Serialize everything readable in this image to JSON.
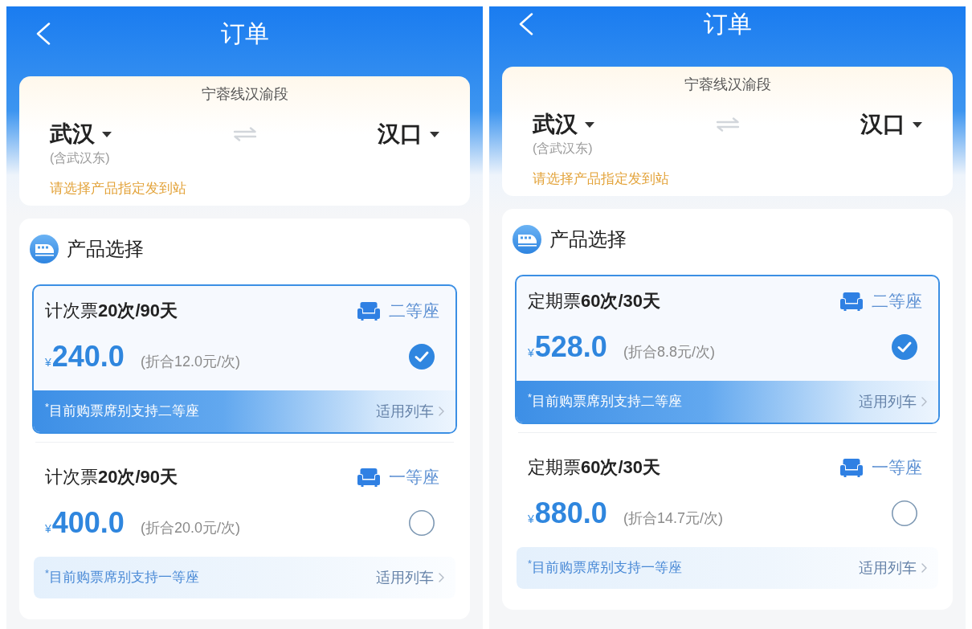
{
  "screens": [
    {
      "header": {
        "title": "订单"
      },
      "route": {
        "line": "宁蓉线汉渝段",
        "from": {
          "station": "武汉",
          "note": "(含武汉东)"
        },
        "to": {
          "station": "汉口"
        },
        "hint": "请选择产品指定发到站"
      },
      "products": {
        "title": "产品选择",
        "items": [
          {
            "name": "计次票**20次/90天**",
            "seat": "二等座",
            "currency": "¥",
            "price": "240.0",
            "per_ride": "(折合12.0元/次)",
            "selected": true,
            "note": "$^{*}$目前购票席别支持二等座",
            "link": "适用列车"
          },
          {
            "name": "计次票**20次/90天**",
            "seat": "一等座",
            "currency": "¥",
            "price": "400.0",
            "per_ride": "(折合20.0元/次)",
            "selected": false,
            "note": "$^{*}$目前购票席别支持一等座",
            "link": "适用列车"
          }
        ]
      }
    },
    {
      "header": {
        "title": "订单"
      },
      "route": {
        "line": "宁蓉线汉渝段",
        "from": {
          "station": "武汉",
          "note": "(含武汉东)"
        },
        "to": {
          "station": "汉口"
        },
        "hint": "请选择产品指定发到站"
      },
      "products": {
        "title": "产品选择",
        "items": [
          {
            "name": "定期票**60次/30天**",
            "seat": "二等座",
            "currency": "¥",
            "price": "528.0",
            "per_ride": "(折合8.8元/次)",
            "selected": true,
            "note": "$^{*}$目前购票席别支持二等座",
            "link": "适用列车"
          },
          {
            "name": "定期票**60次/30天**",
            "seat": "一等座",
            "currency": "¥",
            "price": "880.0",
            "per_ride": "(折合14.7元/次)",
            "selected": false,
            "note": "$^{*}$目前购票席别支持一等座",
            "link": "适用列车"
          }
        ]
      }
    }
  ]
}
